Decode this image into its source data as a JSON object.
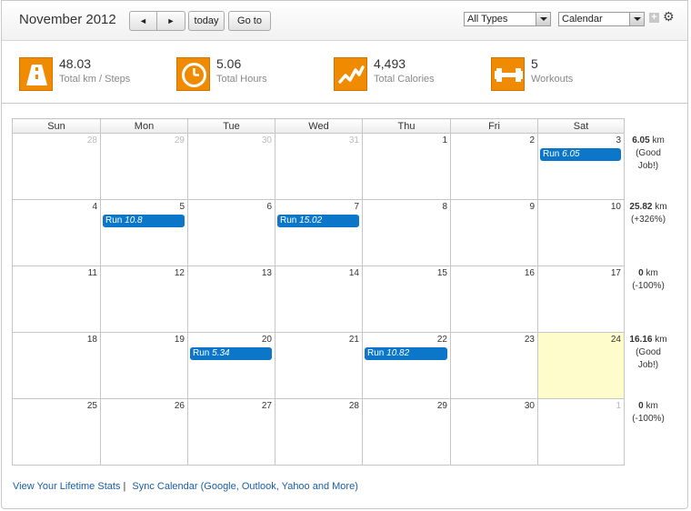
{
  "header": {
    "month_title": "November 2012",
    "prev_label": "◄",
    "next_label": "►",
    "today_label": "today",
    "goto_label": "Go to",
    "types_select": "All Types",
    "view_select": "Calendar",
    "add_label": "+",
    "settings_label": "⚙"
  },
  "stats": [
    {
      "icon": "road-icon",
      "value": "48.03",
      "label": "Total km / Steps"
    },
    {
      "icon": "clock-icon",
      "value": "5.06",
      "label": "Total Hours"
    },
    {
      "icon": "activity-chart-icon",
      "value": "4,493",
      "label": "Total Calories"
    },
    {
      "icon": "dumbbell-icon",
      "value": "5",
      "label": "Workouts"
    }
  ],
  "weekdays": [
    "Sun",
    "Mon",
    "Tue",
    "Wed",
    "Thu",
    "Fri",
    "Sat"
  ],
  "weeks": [
    {
      "days": [
        {
          "n": "28",
          "other": true
        },
        {
          "n": "29",
          "other": true
        },
        {
          "n": "30",
          "other": true
        },
        {
          "n": "31",
          "other": true
        },
        {
          "n": "1"
        },
        {
          "n": "2"
        },
        {
          "n": "3",
          "event": {
            "type": "Run",
            "value": "6.05"
          }
        }
      ],
      "summary": {
        "value": "6.05",
        "unit": "km",
        "note": "(Good Job!)"
      }
    },
    {
      "days": [
        {
          "n": "4"
        },
        {
          "n": "5",
          "event": {
            "type": "Run",
            "value": "10.8"
          }
        },
        {
          "n": "6"
        },
        {
          "n": "7",
          "event": {
            "type": "Run",
            "value": "15.02"
          }
        },
        {
          "n": "8"
        },
        {
          "n": "9"
        },
        {
          "n": "10"
        }
      ],
      "summary": {
        "value": "25.82",
        "unit": "km",
        "note": "(+326%)"
      }
    },
    {
      "days": [
        {
          "n": "11"
        },
        {
          "n": "12"
        },
        {
          "n": "13"
        },
        {
          "n": "14"
        },
        {
          "n": "15"
        },
        {
          "n": "16"
        },
        {
          "n": "17"
        }
      ],
      "summary": {
        "value": "0",
        "unit": "km",
        "note": "(-100%)"
      }
    },
    {
      "days": [
        {
          "n": "18"
        },
        {
          "n": "19"
        },
        {
          "n": "20",
          "event": {
            "type": "Run",
            "value": "5.34"
          }
        },
        {
          "n": "21"
        },
        {
          "n": "22",
          "event": {
            "type": "Run",
            "value": "10.82"
          }
        },
        {
          "n": "23"
        },
        {
          "n": "24",
          "today": true
        }
      ],
      "summary": {
        "value": "16.16",
        "unit": "km",
        "note": "(Good Job!)"
      }
    },
    {
      "days": [
        {
          "n": "25"
        },
        {
          "n": "26"
        },
        {
          "n": "27"
        },
        {
          "n": "28"
        },
        {
          "n": "29"
        },
        {
          "n": "30"
        },
        {
          "n": "1",
          "other": true
        }
      ],
      "summary": {
        "value": "0",
        "unit": "km",
        "note": "(-100%)"
      }
    }
  ],
  "footer": {
    "lifetime_link": "View Your Lifetime Stats",
    "separator": "|",
    "sync_link": "Sync Calendar (Google, Outlook, Yahoo and More)"
  },
  "colors": {
    "accent": "#f08a00",
    "event": "#0c76c8",
    "today": "#fffccc",
    "link": "#1a5fa8"
  }
}
